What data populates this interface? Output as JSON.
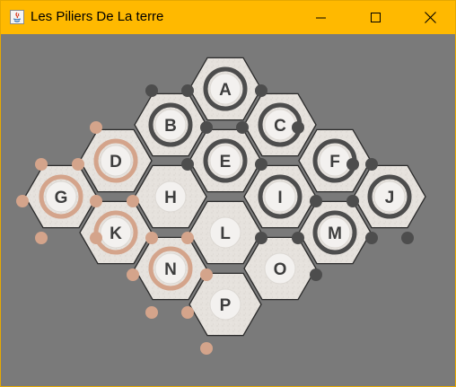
{
  "window": {
    "title": "Les Piliers De La terre",
    "controls": {
      "minimize": "minimize-icon",
      "maximize": "maximize-icon",
      "close": "close-icon"
    },
    "accent": "#ffb900"
  },
  "colors": {
    "background": "#7a7a7a",
    "hex_fill": "#e6e2dd",
    "hex_stroke": "#2b2b2b",
    "dark_piece": "#4d4d4d",
    "copper_piece": "#d4a48b",
    "center_fill": "#f3f1ef"
  },
  "board": {
    "hexes": [
      {
        "label": "A",
        "ring": "dark"
      },
      {
        "label": "B",
        "ring": "dark"
      },
      {
        "label": "C",
        "ring": "dark"
      },
      {
        "label": "D",
        "ring": "copper"
      },
      {
        "label": "E",
        "ring": "dark"
      },
      {
        "label": "F",
        "ring": "dark"
      },
      {
        "label": "G",
        "ring": "copper"
      },
      {
        "label": "H",
        "ring": "none"
      },
      {
        "label": "I",
        "ring": "dark"
      },
      {
        "label": "J",
        "ring": "dark"
      },
      {
        "label": "K",
        "ring": "copper"
      },
      {
        "label": "L",
        "ring": "none"
      },
      {
        "label": "M",
        "ring": "dark"
      },
      {
        "label": "N",
        "ring": "copper"
      },
      {
        "label": "O",
        "ring": "none"
      },
      {
        "label": "P",
        "ring": "none"
      }
    ]
  }
}
